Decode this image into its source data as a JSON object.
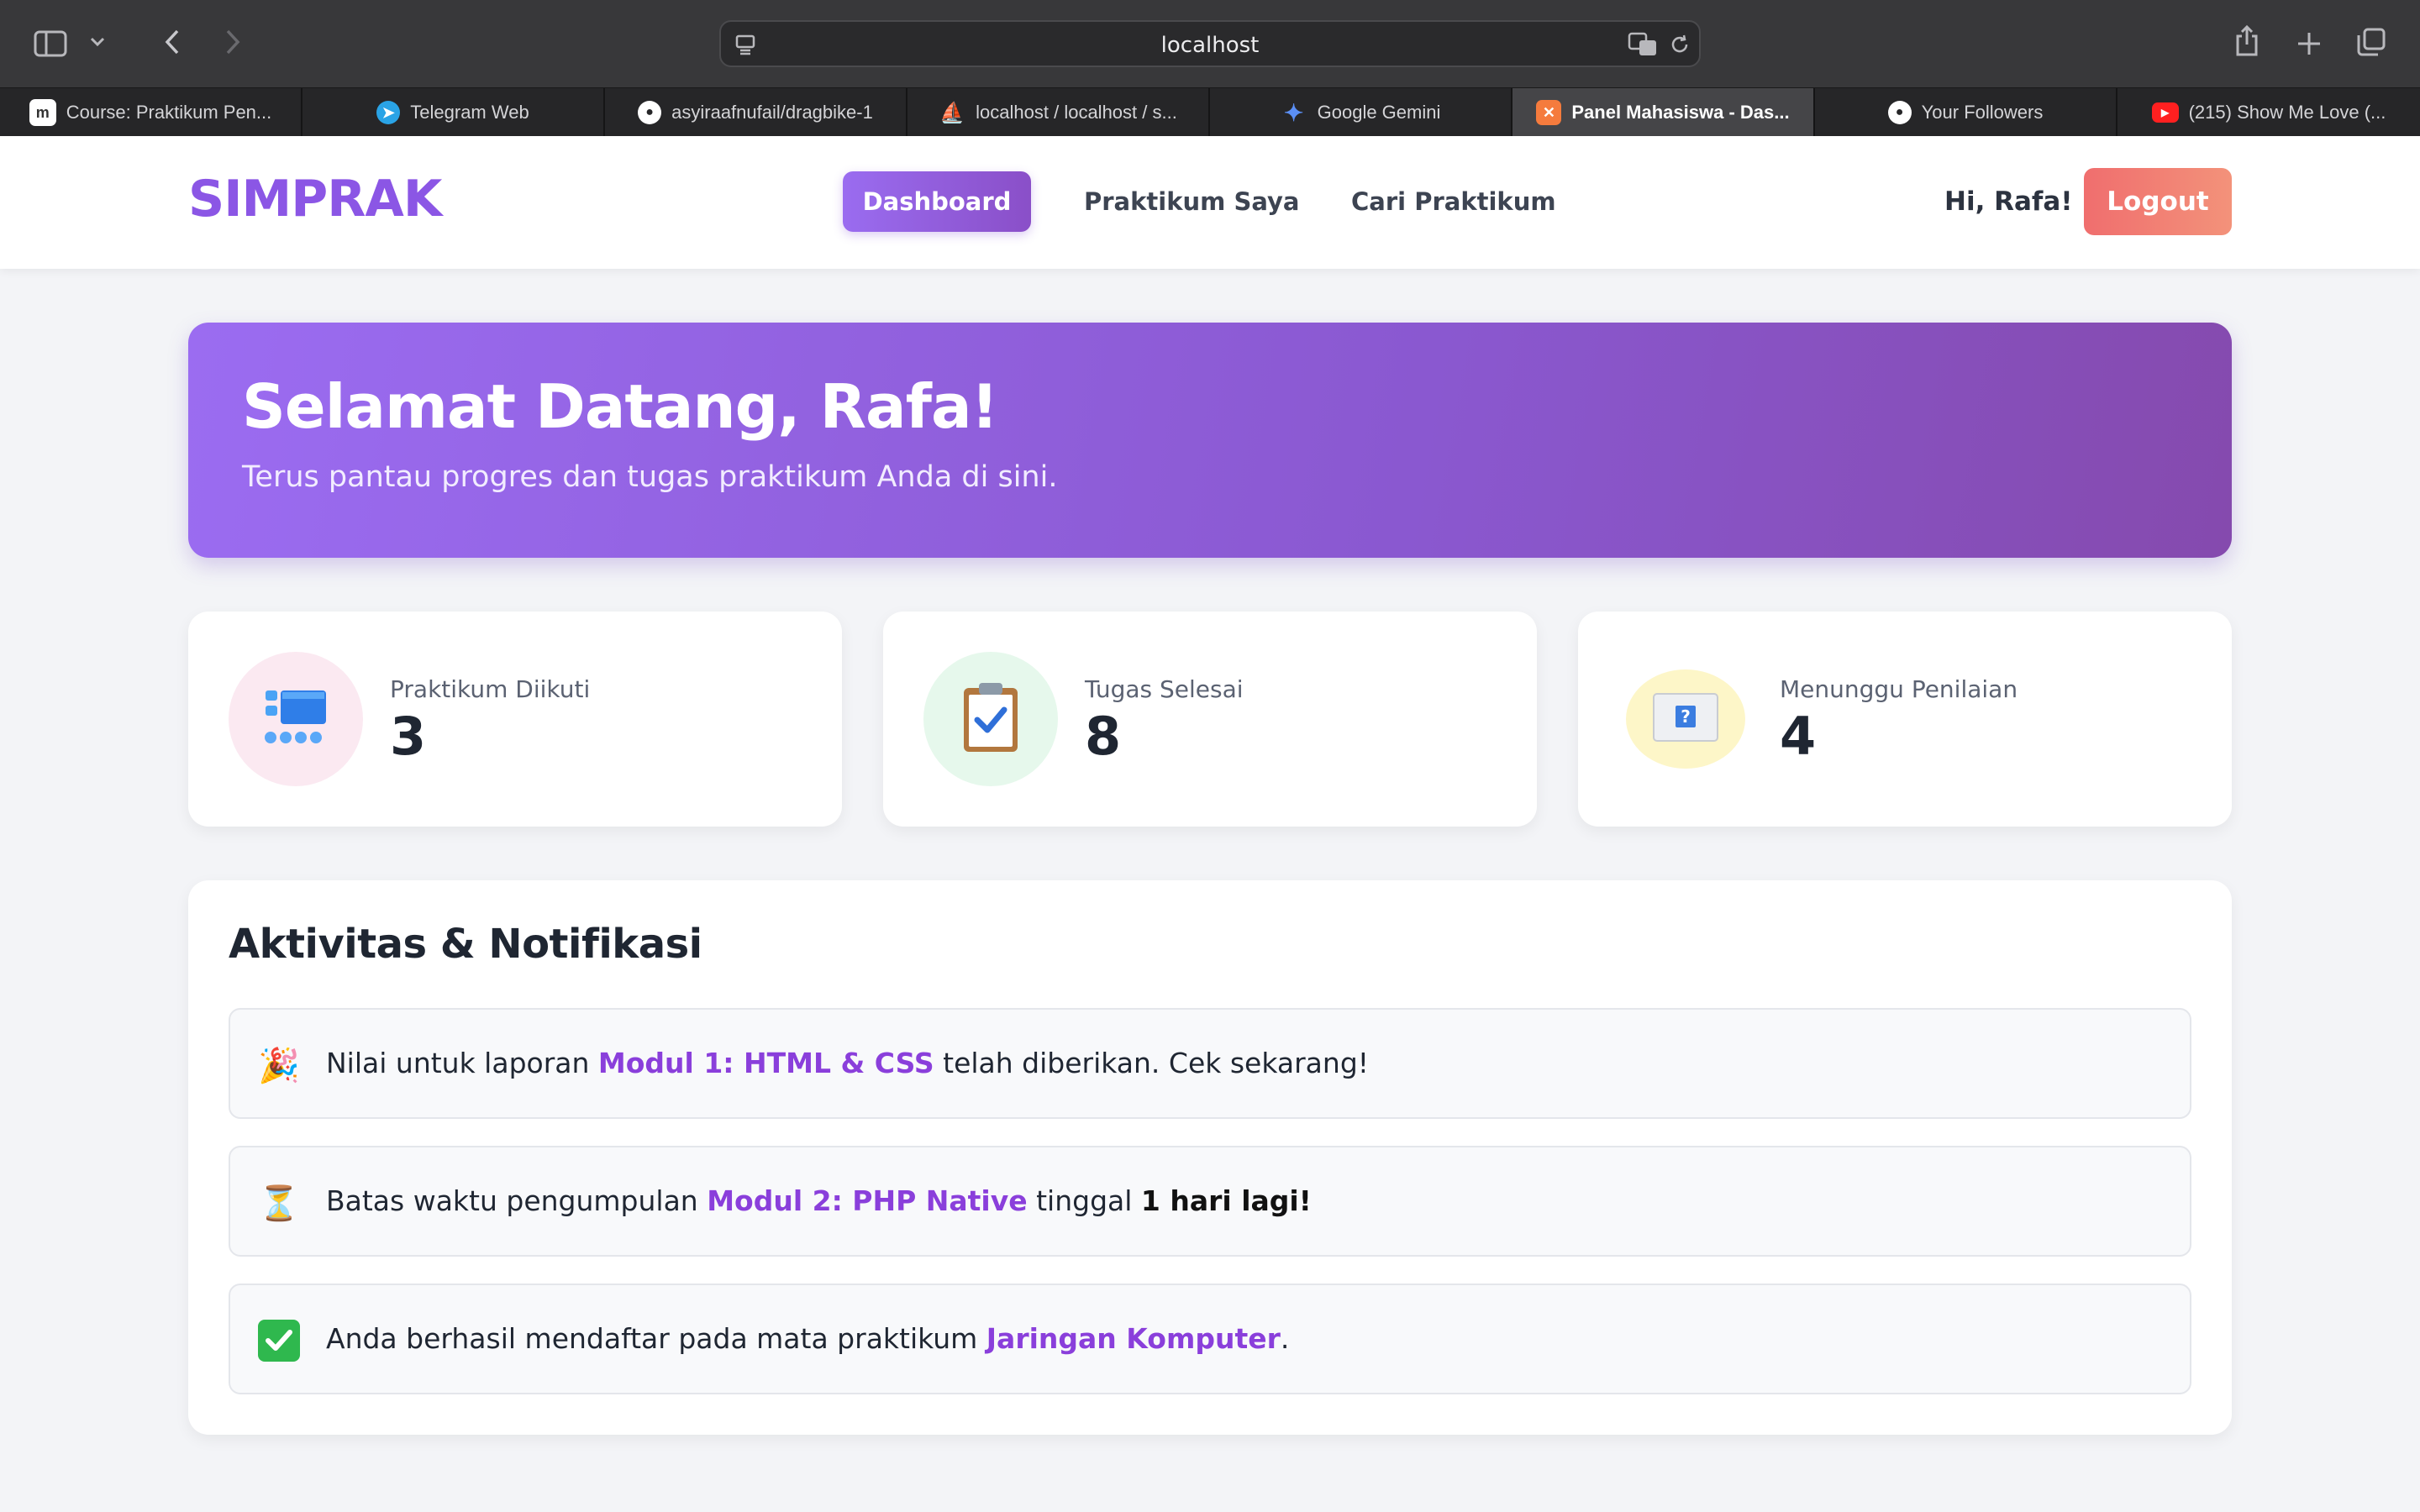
{
  "browser": {
    "url": "localhost",
    "tabs": [
      {
        "label": "Course: Praktikum Pen...",
        "favicon": "moodle-icon",
        "color": "#ffffff"
      },
      {
        "label": "Telegram Web",
        "favicon": "telegram-icon",
        "color": "#2aa3e6"
      },
      {
        "label": "asyiraafnufail/dragbike-1",
        "favicon": "github-icon",
        "color": "#ffffff"
      },
      {
        "label": "localhost / localhost / s...",
        "favicon": "phpmyadmin-icon",
        "color": "#f0a020"
      },
      {
        "label": "Google Gemini",
        "favicon": "gemini-icon",
        "color": "#5b8ff5"
      },
      {
        "label": "Panel Mahasiswa - Das...",
        "favicon": "xampp-icon",
        "color": "#f57b3d",
        "active": true
      },
      {
        "label": "Your Followers",
        "favicon": "github-icon",
        "color": "#ffffff"
      },
      {
        "label": "(215) Show Me Love (...",
        "favicon": "youtube-icon",
        "color": "#ff2020"
      }
    ]
  },
  "navbar": {
    "brand": "SIMPRAK",
    "links": [
      {
        "label": "Dashboard",
        "active": true
      },
      {
        "label": "Praktikum Saya",
        "active": false
      },
      {
        "label": "Cari Praktikum",
        "active": false
      }
    ],
    "greeting": "Hi, Rafa!",
    "logout_label": "Logout"
  },
  "hero": {
    "title": "Selamat Datang, Rafa!",
    "subtitle": "Terus pantau progres dan tugas praktikum Anda di sini."
  },
  "stats": [
    {
      "label": "Praktikum Diikuti",
      "value": "3",
      "icon": "dashboard-icon",
      "circle_color": "#fbe9f1"
    },
    {
      "label": "Tugas Selesai",
      "value": "8",
      "icon": "clipboard-check-icon",
      "circle_color": "#e6f8ec"
    },
    {
      "label": "Menunggu Penilaian",
      "value": "4",
      "icon": "question-box-icon",
      "circle_color": "#fdf6c8"
    }
  ],
  "activity": {
    "title": "Aktivitas & Notifikasi",
    "items": [
      {
        "icon": "party-popper-icon",
        "emoji": "🎉",
        "before": "Nilai untuk laporan ",
        "highlight": "Modul 1: HTML & CSS",
        "after": " telah diberikan. Cek sekarang!"
      },
      {
        "icon": "hourglass-icon",
        "emoji": "⏳",
        "before": "Batas waktu pengumpulan ",
        "highlight": "Modul 2: PHP Native",
        "middle": " tinggal ",
        "bold": "1 hari lagi!"
      },
      {
        "icon": "check-mark-icon",
        "emoji": "✅",
        "before": "Anda berhasil mendaftar pada mata praktikum ",
        "highlight": "Jaringan Komputer",
        "after": "."
      }
    ]
  }
}
